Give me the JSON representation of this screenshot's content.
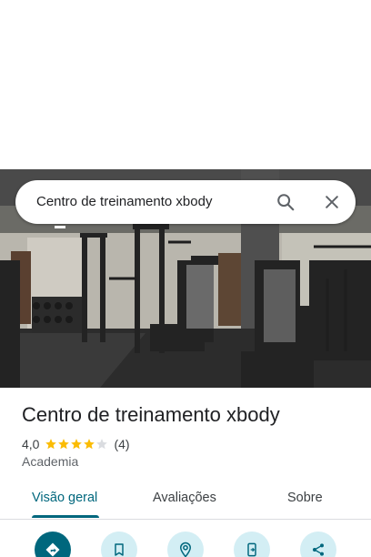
{
  "search": {
    "query": "Centro de treinamento xbody",
    "search_icon": "search-icon",
    "close_icon": "close-icon"
  },
  "place": {
    "name": "Centro de treinamento xbody",
    "rating": "4,0",
    "stars_filled": 4,
    "stars_total": 5,
    "review_count": "(4)",
    "category": "Academia"
  },
  "tabs": [
    {
      "label": "Visão geral",
      "active": true
    },
    {
      "label": "Avaliações",
      "active": false
    },
    {
      "label": "Sobre",
      "active": false
    }
  ],
  "actions": [
    {
      "icon": "directions-icon"
    },
    {
      "icon": "bookmark-icon"
    },
    {
      "icon": "nearby-icon"
    },
    {
      "icon": "send-to-phone-icon"
    },
    {
      "icon": "share-icon"
    }
  ],
  "colors": {
    "accent": "#00677d",
    "action_bg": "#d3eef4",
    "star": "#fbbc04",
    "star_empty": "#dadce0"
  }
}
